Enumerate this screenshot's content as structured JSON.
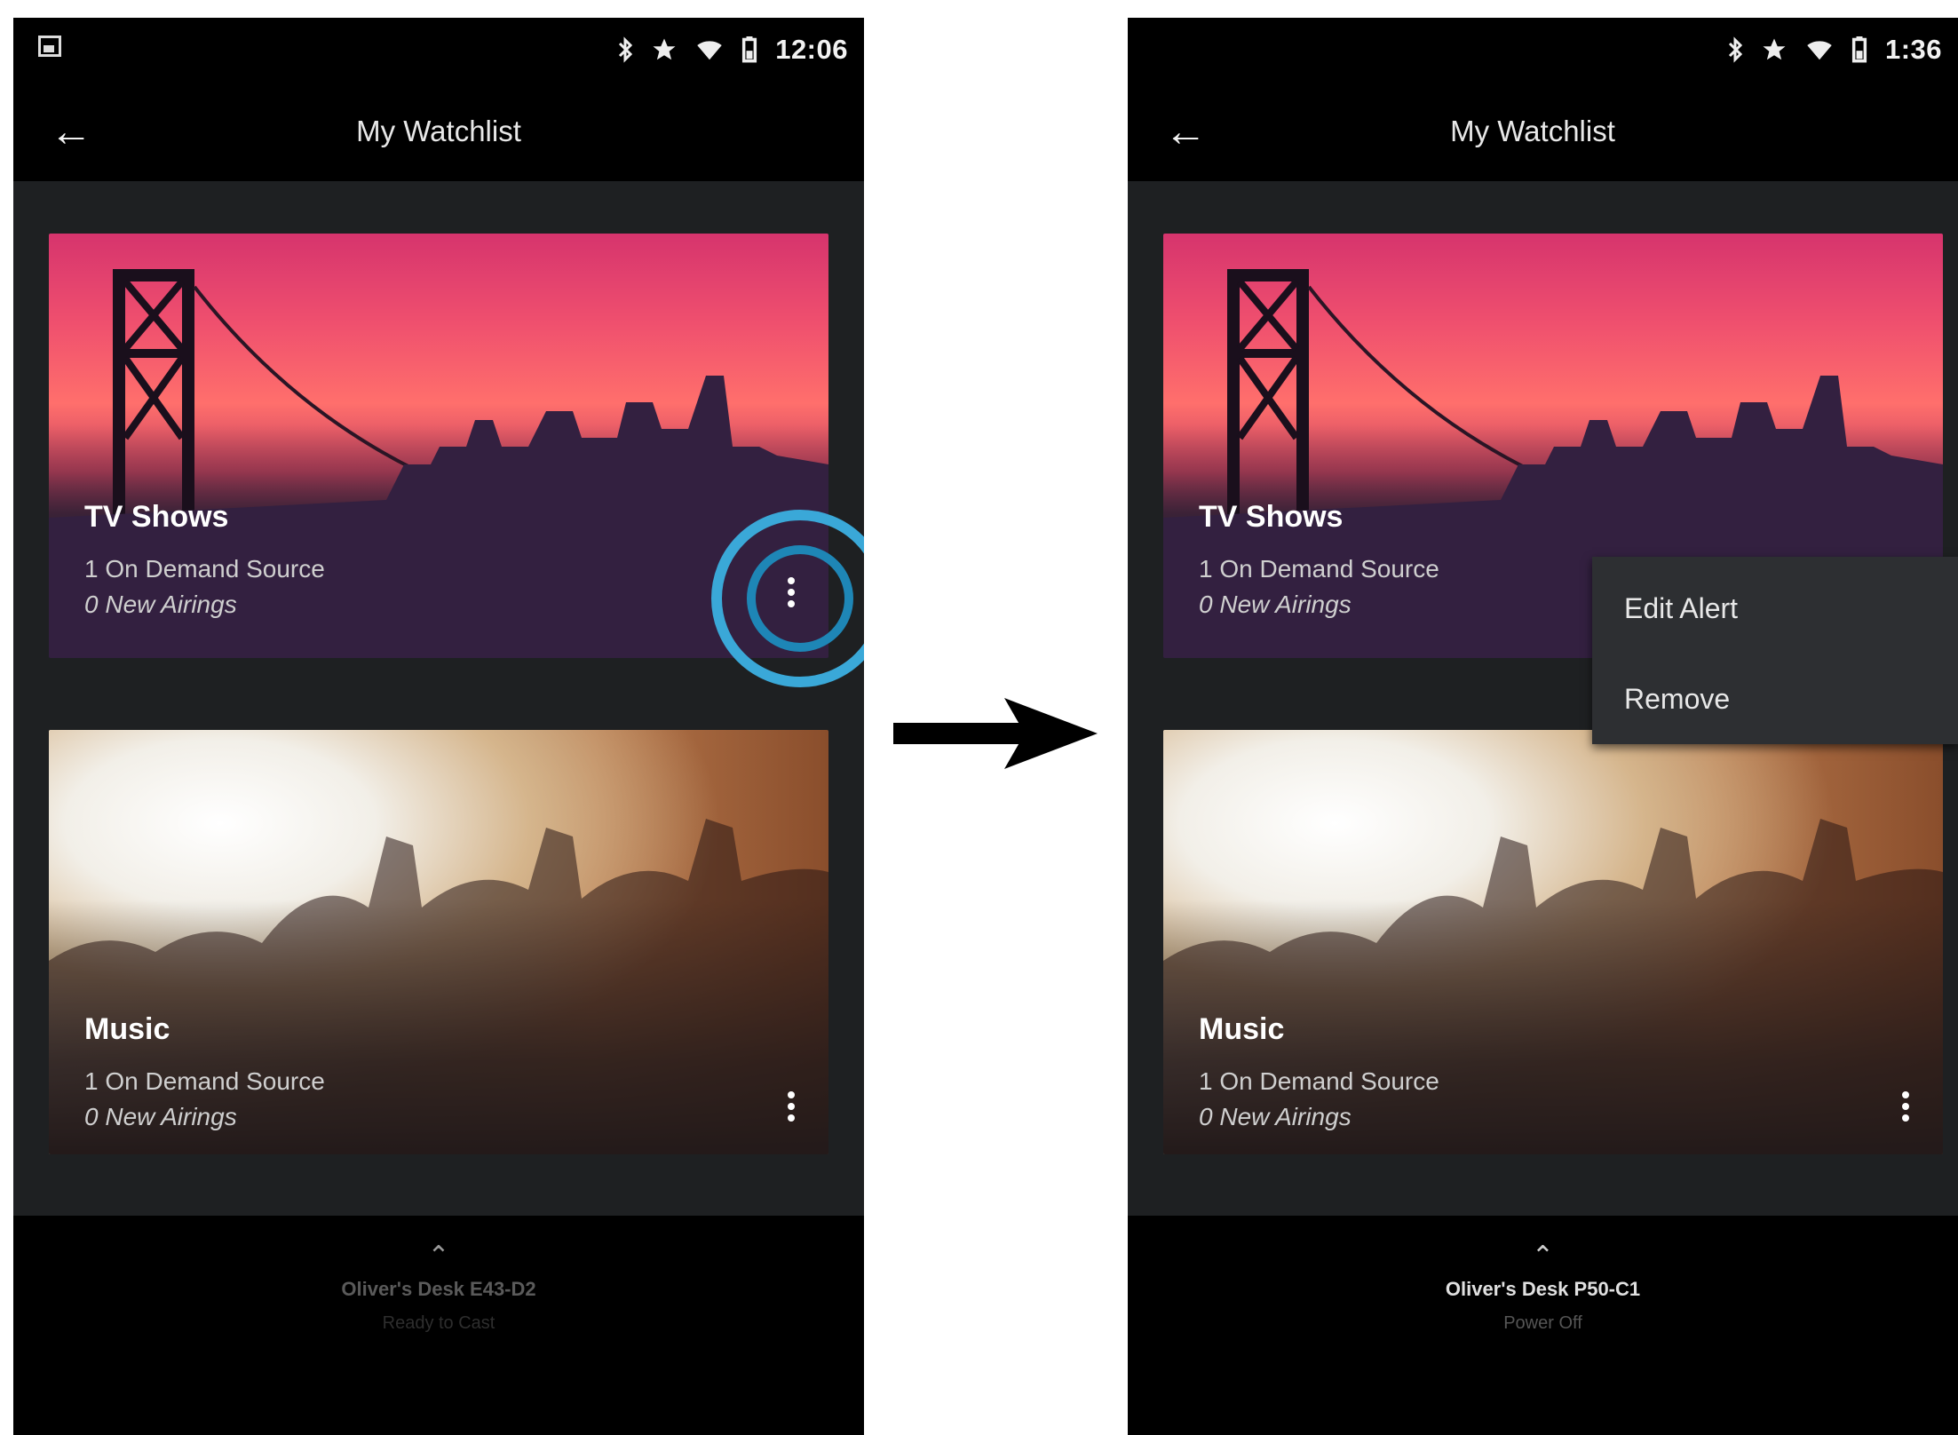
{
  "left_screen": {
    "status_time": "12:06",
    "title": "My Watchlist",
    "cards": [
      {
        "title": "TV Shows",
        "source": "1 On Demand Source",
        "airings": "0 New Airings"
      },
      {
        "title": "Music",
        "source": "1 On Demand Source",
        "airings": "0 New Airings"
      }
    ],
    "device_name": "Oliver's Desk E43-D2",
    "device_status": "Ready to Cast"
  },
  "right_screen": {
    "status_time": "1:36",
    "title": "My Watchlist",
    "cards": [
      {
        "title": "TV Shows",
        "source": "1 On Demand Source",
        "airings": "0 New Airings"
      },
      {
        "title": "Music",
        "source": "1 On Demand Source",
        "airings": "0 New Airings"
      }
    ],
    "menu": {
      "edit": "Edit Alert",
      "remove": "Remove"
    },
    "device_name": "Oliver's Desk P50-C1",
    "device_status": "Power Off"
  },
  "icons": [
    "image-icon",
    "bluetooth-icon",
    "star-icon",
    "wifi-icon",
    "battery-icon",
    "back-arrow-icon",
    "more-vert-icon",
    "chevron-up-icon",
    "right-arrow-icon"
  ],
  "colors": {
    "highlight": "#2a9ac8",
    "bar": "#000000",
    "background": "#1e2022"
  }
}
